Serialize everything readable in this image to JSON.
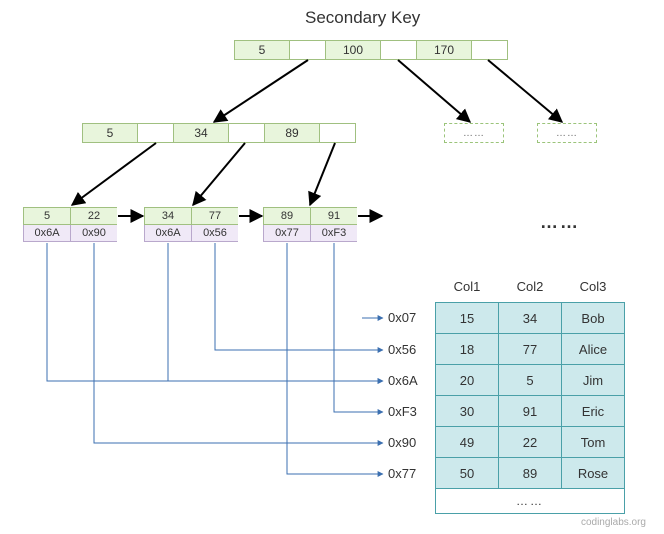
{
  "title": "Secondary Key",
  "root": {
    "keys": [
      "5",
      "100",
      "170"
    ]
  },
  "internal": {
    "keys": [
      "5",
      "34",
      "89"
    ]
  },
  "dashed_label": "……",
  "leaves": [
    {
      "keys": [
        "5",
        "22"
      ],
      "ptrs": [
        "0x6A",
        "0x90"
      ]
    },
    {
      "keys": [
        "34",
        "77"
      ],
      "ptrs": [
        "0x6A",
        "0x56"
      ]
    },
    {
      "keys": [
        "89",
        "91"
      ],
      "ptrs": [
        "0x77",
        "0xF3"
      ]
    }
  ],
  "leaf_continuation": "……",
  "addresses": [
    "0x07",
    "0x56",
    "0x6A",
    "0xF3",
    "0x90",
    "0x77"
  ],
  "table": {
    "headers": [
      "Col1",
      "Col2",
      "Col3"
    ],
    "rows": [
      [
        "15",
        "34",
        "Bob"
      ],
      [
        "18",
        "77",
        "Alice"
      ],
      [
        "20",
        "5",
        "Jim"
      ],
      [
        "30",
        "91",
        "Eric"
      ],
      [
        "49",
        "22",
        "Tom"
      ],
      [
        "50",
        "89",
        "Rose"
      ]
    ],
    "ellipsis": "……"
  },
  "attribution": "codinglabs.org"
}
